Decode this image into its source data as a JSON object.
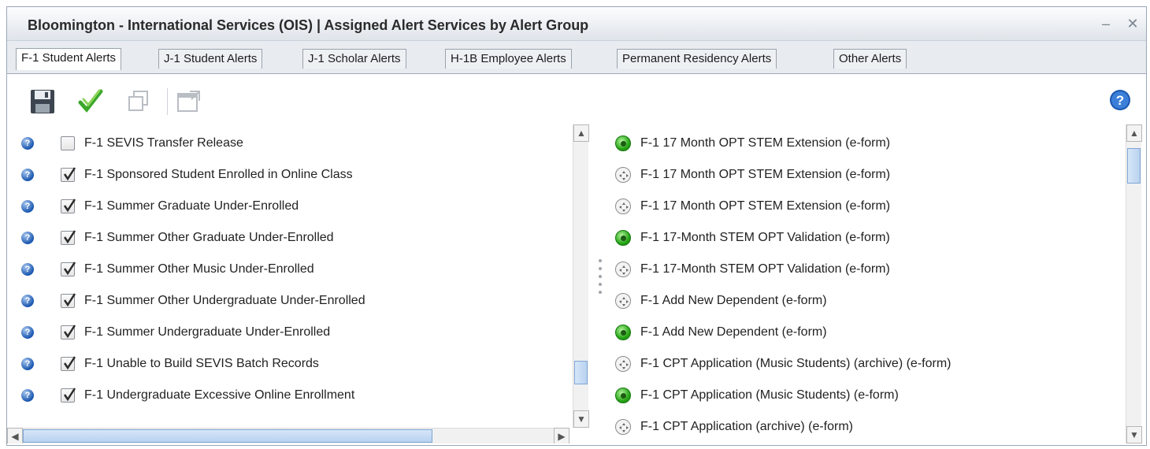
{
  "window": {
    "title": "Bloomington - International Services (OIS) | Assigned Alert Services by Alert Group",
    "minimize_glyph": "–",
    "close_glyph": "✕"
  },
  "tabs": [
    {
      "label": "F-1 Student Alerts",
      "active": true
    },
    {
      "label": "J-1 Student Alerts",
      "active": false
    },
    {
      "label": "J-1 Scholar Alerts",
      "active": false
    },
    {
      "label": "H-1B Employee Alerts",
      "active": false
    },
    {
      "label": "Permanent Residency Alerts",
      "active": false
    },
    {
      "label": "Other Alerts",
      "active": false
    }
  ],
  "toolbar": {
    "icons": [
      "save-icon",
      "approve-icon",
      "copy-icon",
      "export-icon",
      "help-icon"
    ]
  },
  "alerts": [
    {
      "label": "F-1 SEVIS Transfer Release",
      "checked": false
    },
    {
      "label": "F-1 Sponsored Student Enrolled in Online Class",
      "checked": true
    },
    {
      "label": "F-1 Summer Graduate Under-Enrolled",
      "checked": true
    },
    {
      "label": "F-1 Summer Other Graduate Under-Enrolled",
      "checked": true
    },
    {
      "label": "F-1 Summer Other Music Under-Enrolled",
      "checked": true
    },
    {
      "label": "F-1 Summer Other Undergraduate Under-Enrolled",
      "checked": true
    },
    {
      "label": "F-1 Summer Undergraduate Under-Enrolled",
      "checked": true
    },
    {
      "label": "F-1 Unable to Build SEVIS Batch Records",
      "checked": true
    },
    {
      "label": "F-1 Undergraduate Excessive Online Enrollment",
      "checked": true
    }
  ],
  "services": [
    {
      "label": "F-1 17 Month OPT STEM Extension (e-form)",
      "status": "active"
    },
    {
      "label": "F-1 17 Month OPT STEM Extension (e-form)",
      "status": "inactive"
    },
    {
      "label": "F-1 17 Month OPT STEM Extension (e-form)",
      "status": "inactive"
    },
    {
      "label": "F-1 17-Month STEM OPT Validation (e-form)",
      "status": "active"
    },
    {
      "label": "F-1 17-Month STEM OPT Validation (e-form)",
      "status": "inactive"
    },
    {
      "label": "F-1 Add New Dependent (e-form)",
      "status": "inactive"
    },
    {
      "label": "F-1 Add New Dependent (e-form)",
      "status": "active"
    },
    {
      "label": "F-1 CPT Application (Music Students) (archive) (e-form)",
      "status": "inactive"
    },
    {
      "label": "F-1 CPT Application (Music Students) (e-form)",
      "status": "active"
    },
    {
      "label": "F-1 CPT Application (archive) (e-form)",
      "status": "inactive"
    }
  ],
  "help_glyph": "?",
  "colors": {
    "active_status": "#27a617",
    "help": "#1a57b0"
  }
}
